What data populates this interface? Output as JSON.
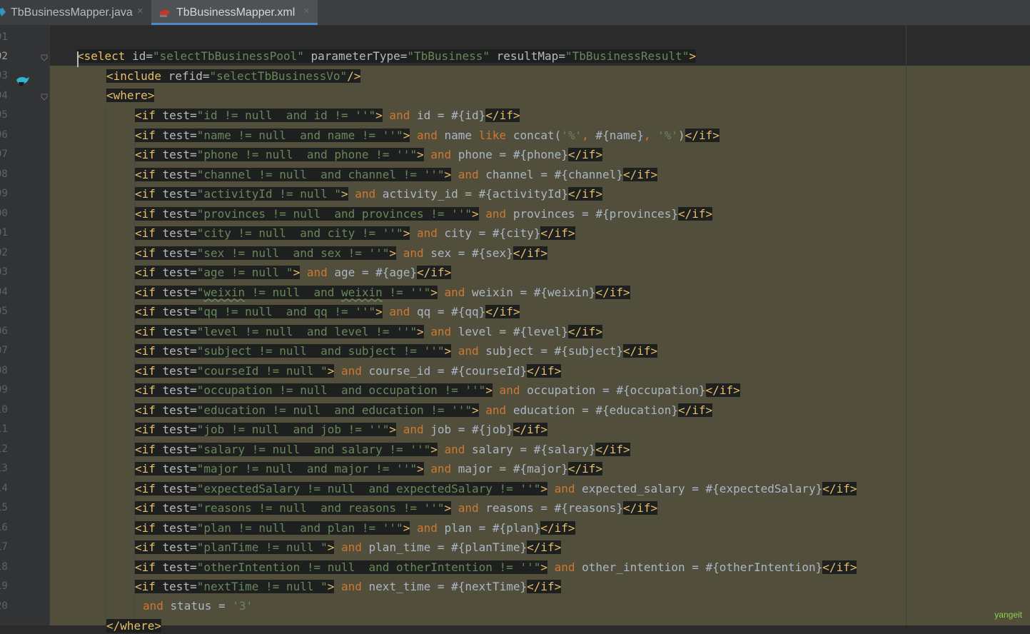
{
  "tabs": [
    {
      "label": "TbBusinessMapper.java",
      "icon": "java-interface-icon",
      "active": false
    },
    {
      "label": "TbBusinessMapper.xml",
      "icon": "mybatis-xml-icon",
      "active": true
    }
  ],
  "gutter": {
    "line_numbers": [
      "91",
      "92",
      "93",
      "94",
      "95",
      "96",
      "97",
      "98",
      "99",
      "00",
      "01",
      "02",
      "03",
      "04",
      "05",
      "06",
      "07",
      "08",
      "09",
      "10",
      "11",
      "12",
      "13",
      "14",
      "15",
      "16",
      "17",
      "18",
      "19",
      "20"
    ],
    "current_line": "92"
  },
  "colors": {
    "tag": "#e8bf6a",
    "attribute": "#bababa",
    "value": "#6a8759",
    "keyword": "#cc7832",
    "text": "#a9b7c6",
    "scope_highlight": "#524e3c",
    "active_tab_underline": "#4a88c7"
  },
  "code": {
    "select_open": {
      "tag": "<select",
      "attr1": " id=",
      "val1": "\"selectTbBusinessPool\"",
      "attr2": " parameterType=",
      "val2": "\"TbBusiness\"",
      "attr3": " resultMap=",
      "val3": "\"TbBusinessResult\"",
      "close": ">"
    },
    "include": {
      "tag": "<include",
      "attr": " refid=",
      "val": "\"selectTbBusinessVo\"",
      "close": "/>"
    },
    "where_open": "<where>",
    "if_open": "<if",
    "test_attr": " test=",
    "gt": ">",
    "if_close": "</if>",
    "if_lines": [
      {
        "test": "\"id != null  and id != ''\"",
        "kw": " and",
        "body": " id = #{id}"
      },
      {
        "test": "\"name != null  and name != ''\"",
        "kw": " and",
        "body": " name ",
        "kw2": "like",
        "body2": " concat(",
        "s1": "'%'",
        "kw3": ",",
        "body3": " #{name}",
        "kw4": ",",
        "s2": " '%'",
        "body4": ")"
      },
      {
        "test": "\"phone != null  and phone != ''\"",
        "kw": " and",
        "body": " phone = #{phone}"
      },
      {
        "test": "\"channel != null  and channel != ''\"",
        "kw": " and",
        "body": " channel = #{channel}"
      },
      {
        "test": "\"activityId != null \"",
        "kw": " and",
        "body": " activity_id = #{activityId}"
      },
      {
        "test": "\"provinces != null  and provinces != ''\"",
        "kw": " and",
        "body": " provinces = #{provinces}"
      },
      {
        "test": "\"city != null  and city != ''\"",
        "kw": " and",
        "body": " city = #{city}"
      },
      {
        "test": "\"sex != null  and sex != ''\"",
        "kw": " and",
        "body": " sex = #{sex}"
      },
      {
        "test": "\"age != null \"",
        "kw": " and",
        "body": " age = #{age}"
      },
      {
        "test_a": "\"",
        "test_b": "weixin",
        "test_c": " != null  and ",
        "test_d": "weixin",
        "test_e": " != ''\"",
        "kw": " and",
        "body": " weixin = #{weixin}"
      },
      {
        "test": "\"qq != null  and qq != ''\"",
        "kw": " and",
        "body": " qq = #{qq}"
      },
      {
        "test": "\"level != null  and level != ''\"",
        "kw": " and",
        "body": " level = #{level}"
      },
      {
        "test": "\"subject != null  and subject != ''\"",
        "kw": " and",
        "body": " subject = #{subject}"
      },
      {
        "test": "\"courseId != null \"",
        "kw": " and",
        "body": " course_id = #{courseId}"
      },
      {
        "test": "\"occupation != null  and occupation != ''\"",
        "kw": " and",
        "body": " occupation = #{occupation}"
      },
      {
        "test": "\"education != null  and education != ''\"",
        "kw": " and",
        "body": " education = #{education}"
      },
      {
        "test": "\"job != null  and job != ''\"",
        "kw": " and",
        "body": " job = #{job}"
      },
      {
        "test": "\"salary != null  and salary != ''\"",
        "kw": " and",
        "body": " salary = #{salary}"
      },
      {
        "test": "\"major != null  and major != ''\"",
        "kw": " and",
        "body": " major = #{major}"
      },
      {
        "test": "\"expectedSalary != null  and expectedSalary != ''\"",
        "kw": " and",
        "body": " expected_salary = #{expectedSalary}"
      },
      {
        "test": "\"reasons != null  and reasons != ''\"",
        "kw": " and",
        "body": " reasons = #{reasons}"
      },
      {
        "test": "\"plan != null  and plan != ''\"",
        "kw": " and",
        "body": " plan = #{plan}"
      },
      {
        "test": "\"planTime != null \"",
        "kw": " and",
        "body": " plan_time = #{planTime}"
      },
      {
        "test": "\"otherIntention != null  and otherIntention != ''\"",
        "kw": " and",
        "body": " other_intention = #{otherIntention}"
      },
      {
        "test": "\"nextTime != null \"",
        "kw": " and",
        "body": " next_time = #{nextTime}"
      }
    ],
    "status_line": {
      "kw": "and",
      "body": " status = ",
      "val": "'3'"
    },
    "where_close": "</where>"
  },
  "watermark": "yangeit"
}
